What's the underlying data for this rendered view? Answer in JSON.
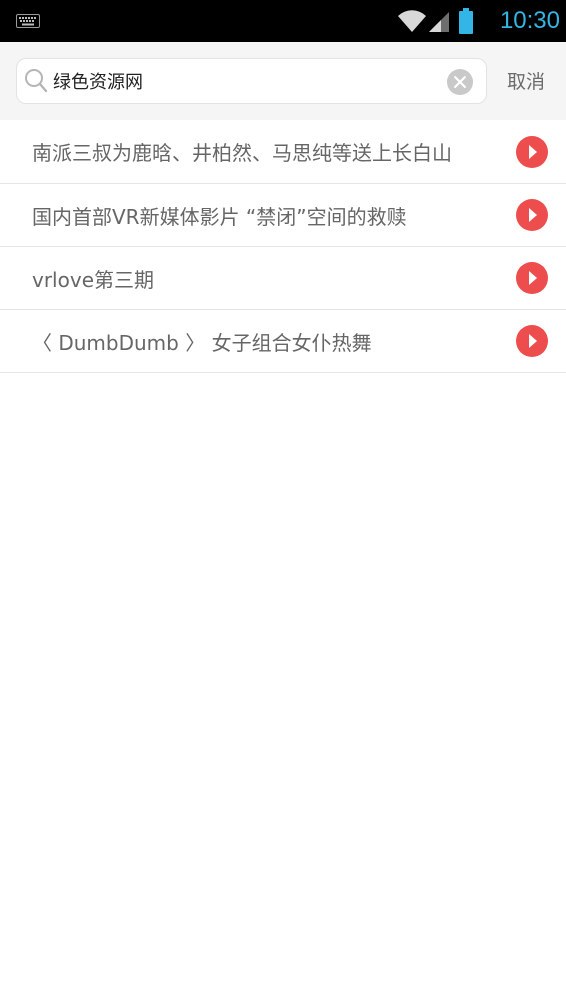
{
  "status_bar": {
    "time": "10:30",
    "icons": [
      "keyboard-icon",
      "wifi-icon",
      "signal-icon",
      "battery-icon"
    ],
    "time_color": "#33b5e5"
  },
  "search": {
    "value": "绿色资源网",
    "icon": "search-icon",
    "clear_icon": "clear-icon",
    "cancel_label": "取消"
  },
  "suggestions": [
    {
      "text": "南派三叔为鹿晗、井柏然、马思纯等送上长白山",
      "icon": "play-icon"
    },
    {
      "text": "国内首部VR新媒体影片 “禁闭”空间的救赎",
      "icon": "play-icon"
    },
    {
      "text": "vrlove第三期",
      "icon": "play-icon"
    },
    {
      "text": "〈 DumbDumb 〉 女子组合女仆热舞",
      "icon": "play-icon"
    }
  ],
  "colors": {
    "accent_play": "#ee4d4d",
    "header_bg": "#f5f5f5",
    "text": "#666666"
  }
}
